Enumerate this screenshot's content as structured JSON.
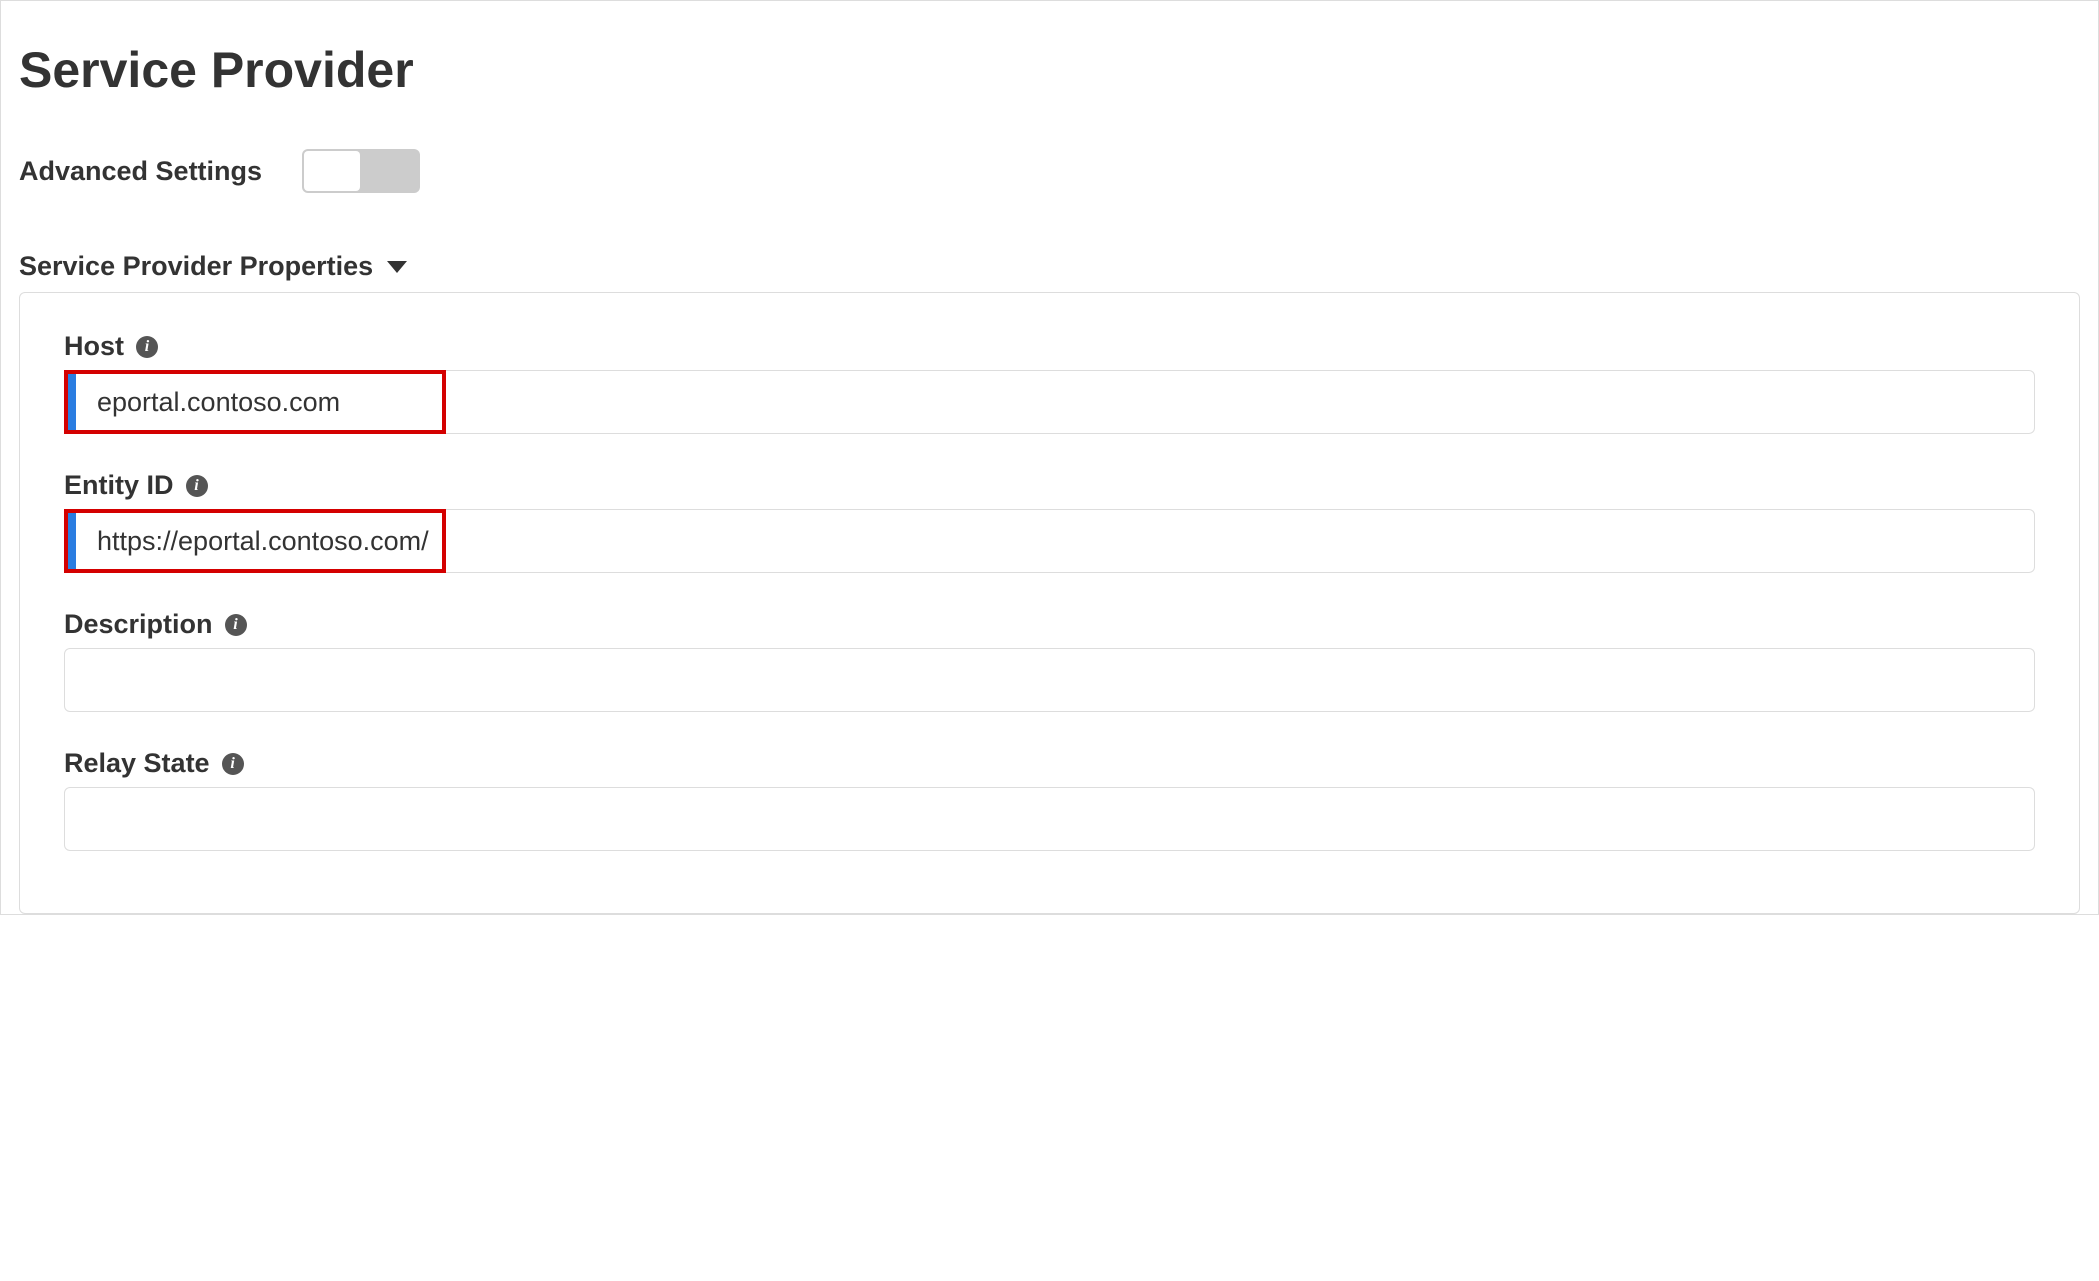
{
  "page": {
    "title": "Service Provider"
  },
  "advanced_settings": {
    "label": "Advanced Settings",
    "enabled": false
  },
  "section": {
    "title": "Service Provider Properties"
  },
  "fields": {
    "host": {
      "label": "Host",
      "value": "eportal.contoso.com"
    },
    "entity_id": {
      "label": "Entity ID",
      "value": "https://eportal.contoso.com/"
    },
    "description": {
      "label": "Description",
      "value": ""
    },
    "relay_state": {
      "label": "Relay State",
      "value": ""
    }
  }
}
